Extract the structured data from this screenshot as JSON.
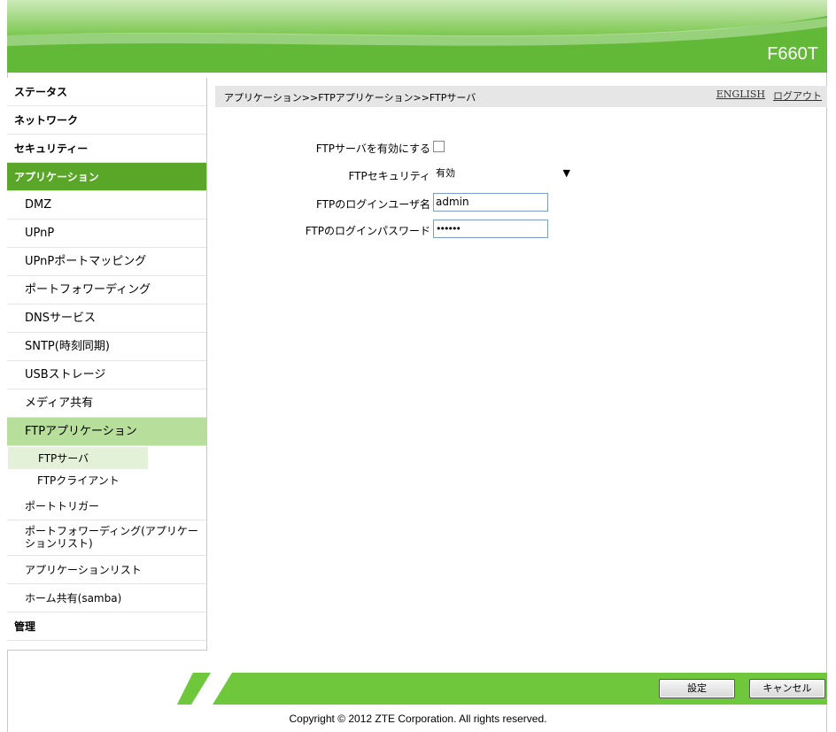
{
  "header": {
    "model": "F660T"
  },
  "breadcrumb": "アプリケーション>>FTPアプリケーション>>FTPサーバ",
  "top_links": {
    "english": "ENGLISH",
    "logout": "ログアウト"
  },
  "sidebar": {
    "status": "ステータス",
    "network": "ネットワーク",
    "security": "セキュリティー",
    "application": "アプリケーション",
    "items": [
      "DMZ",
      "UPnP",
      "UPnPポートマッピング",
      "ポートフォワーディング",
      "DNSサービス",
      "SNTP(時刻同期)",
      "USBストレージ",
      "メディア共有"
    ],
    "ftp_app": "FTPアプリケーション",
    "ftp_server": "FTPサーバ",
    "ftp_client": "FTPクライアント",
    "port_trigger": "ポートトリガー",
    "port_forward_app": "ポートフォワーディング(アプリケーションリスト)",
    "app_list": "アプリケーションリスト",
    "home_share": "ホーム共有(samba)",
    "management": "管理"
  },
  "form": {
    "enable_label": "FTPサーバを有効にする",
    "enable_checked": false,
    "security_label": "FTPセキュリティ",
    "security_value": "有効",
    "user_label": "FTPのログインユーザ名",
    "user_value": "admin",
    "password_label": "FTPのログインパスワード",
    "password_value": "••••••"
  },
  "buttons": {
    "apply": "設定",
    "cancel": "キャンセル"
  },
  "copyright": "Copyright © 2012 ZTE Corporation. All rights reserved.",
  "colors": {
    "brand_green": "#6cc13f",
    "active_green": "#5aa629",
    "light_green": "#b7de9b"
  }
}
